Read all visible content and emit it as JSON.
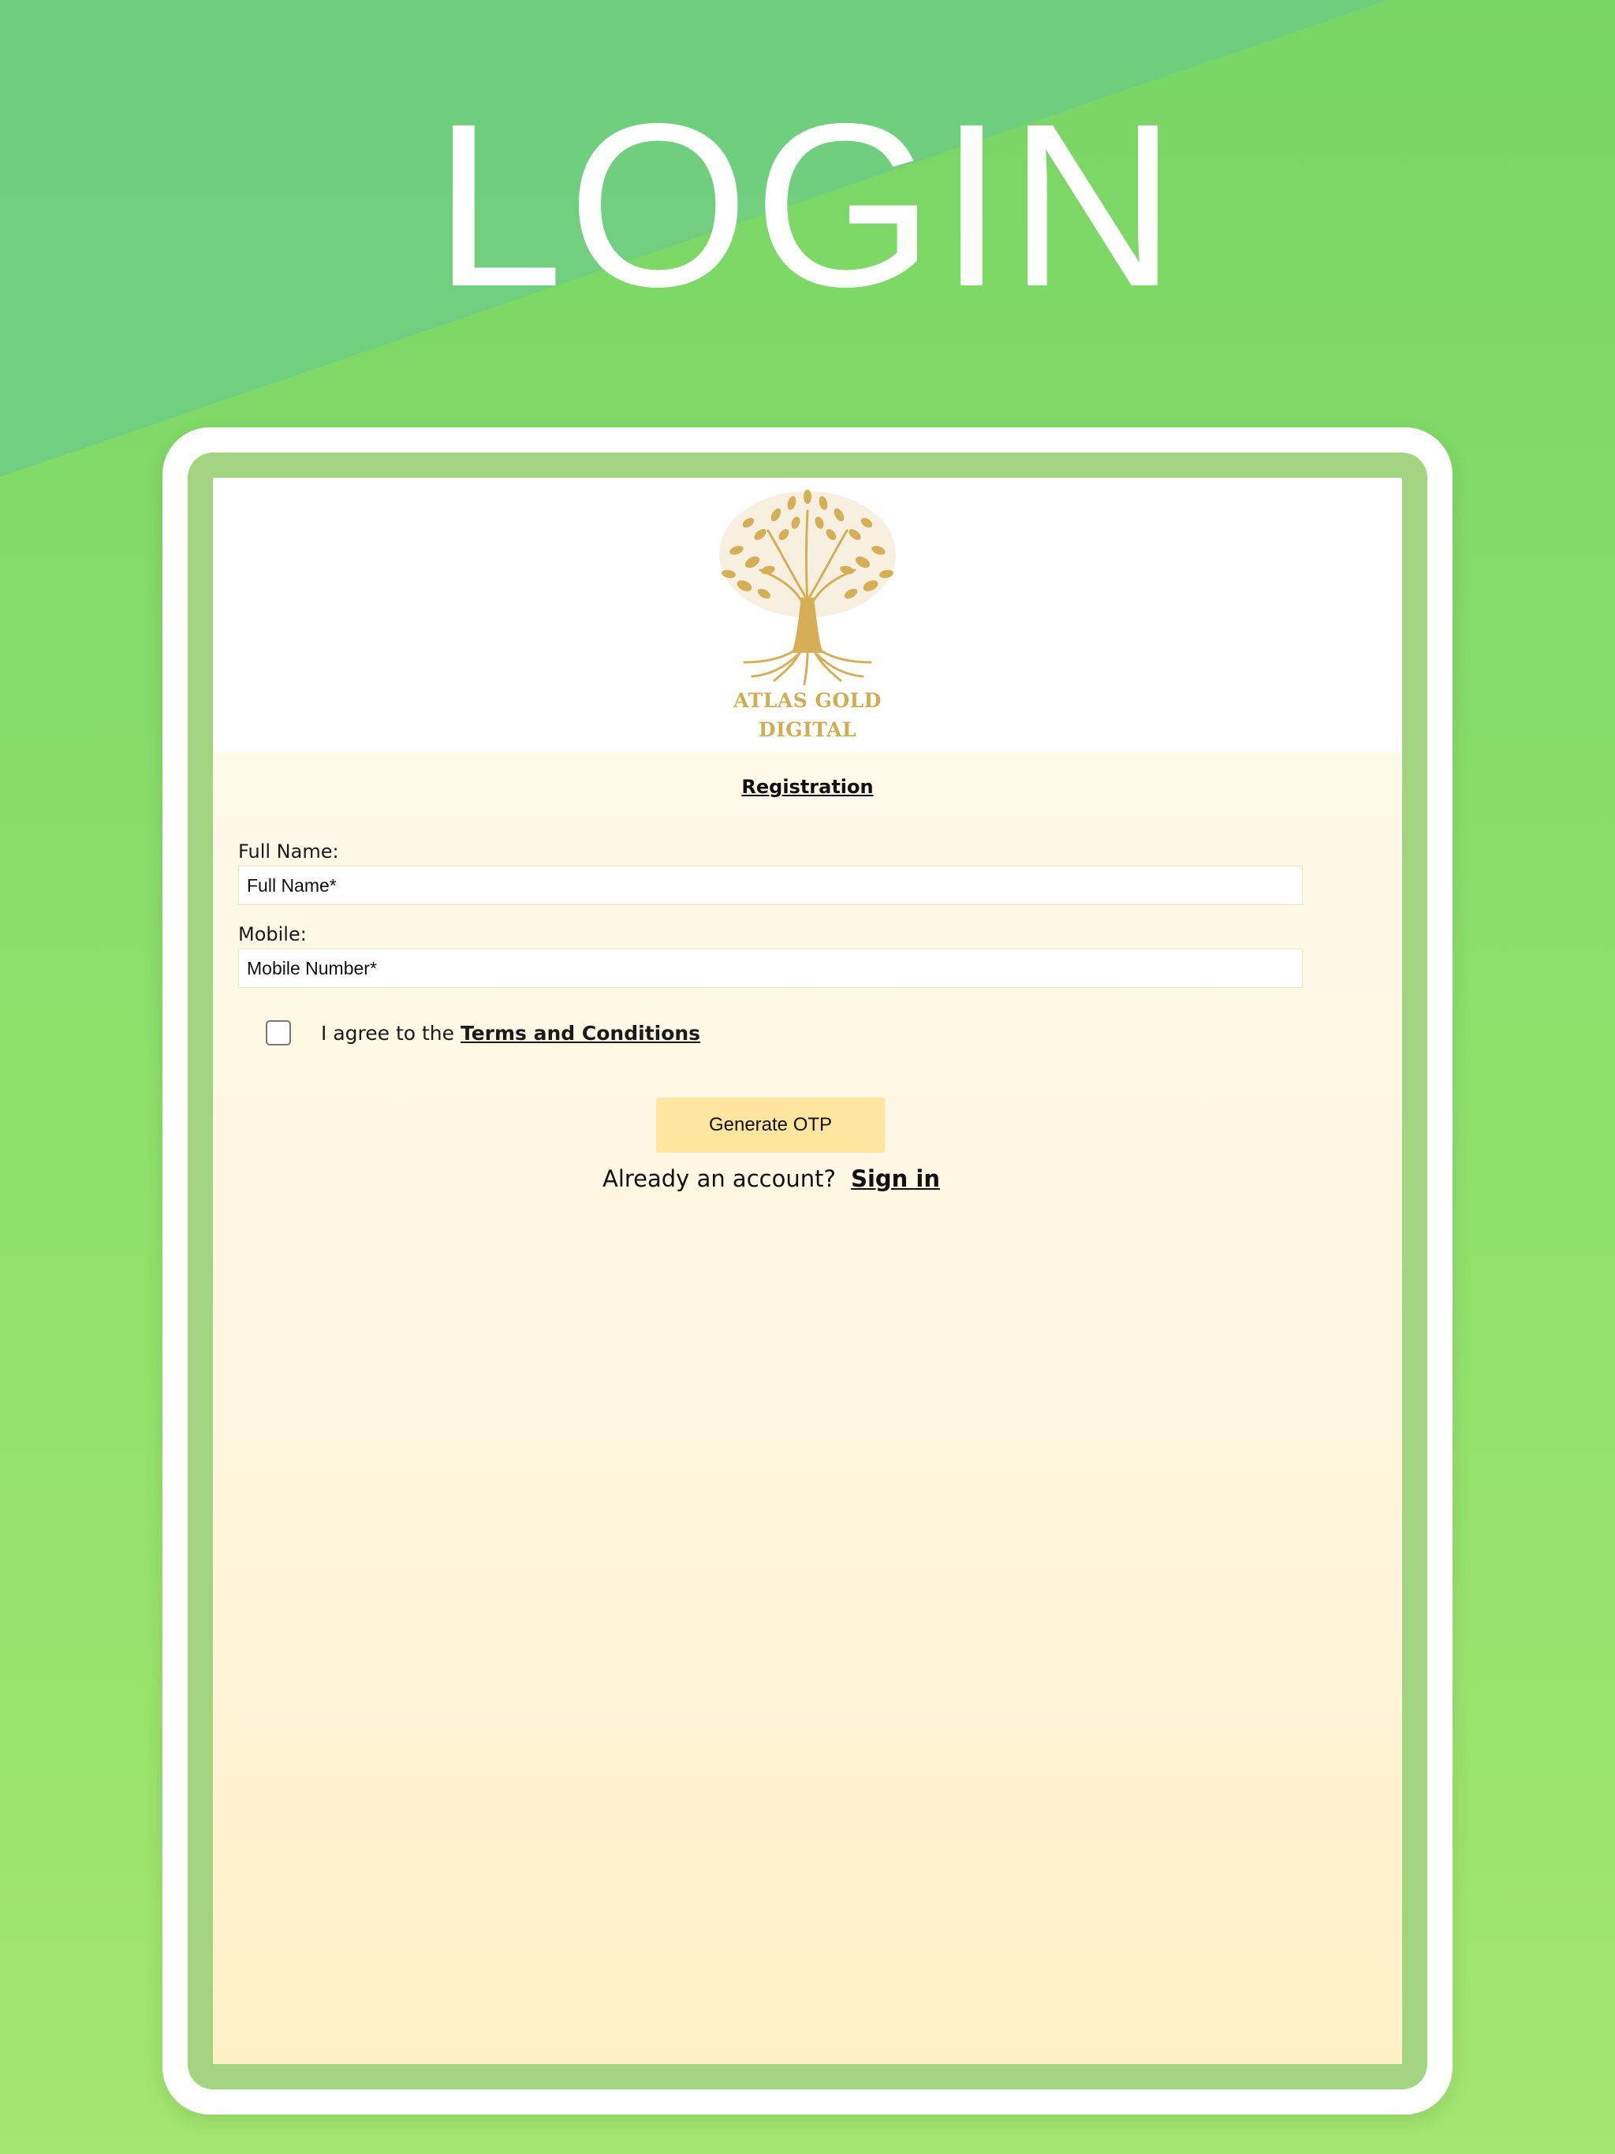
{
  "hero": {
    "title": "LOGIN"
  },
  "brand": {
    "name_line1": "ATLAS GOLD",
    "name_line2": "DIGITAL",
    "logo_icon": "tree-icon",
    "gold_color": "#d1ac52"
  },
  "form": {
    "title": "Registration",
    "full_name": {
      "label": "Full Name:",
      "placeholder": "Full Name*",
      "value": ""
    },
    "mobile": {
      "label": "Mobile:",
      "placeholder": "Mobile Number*",
      "value": ""
    },
    "terms": {
      "prefix": "I agree to the",
      "link_text": "Terms and Conditions",
      "checked": false
    },
    "submit_label": "Generate OTP",
    "account_prompt": "Already an account?",
    "signin_label": "Sign in"
  },
  "colors": {
    "background": "#8de06a",
    "button": "#ffe6a0",
    "screen": "#fff6df"
  }
}
